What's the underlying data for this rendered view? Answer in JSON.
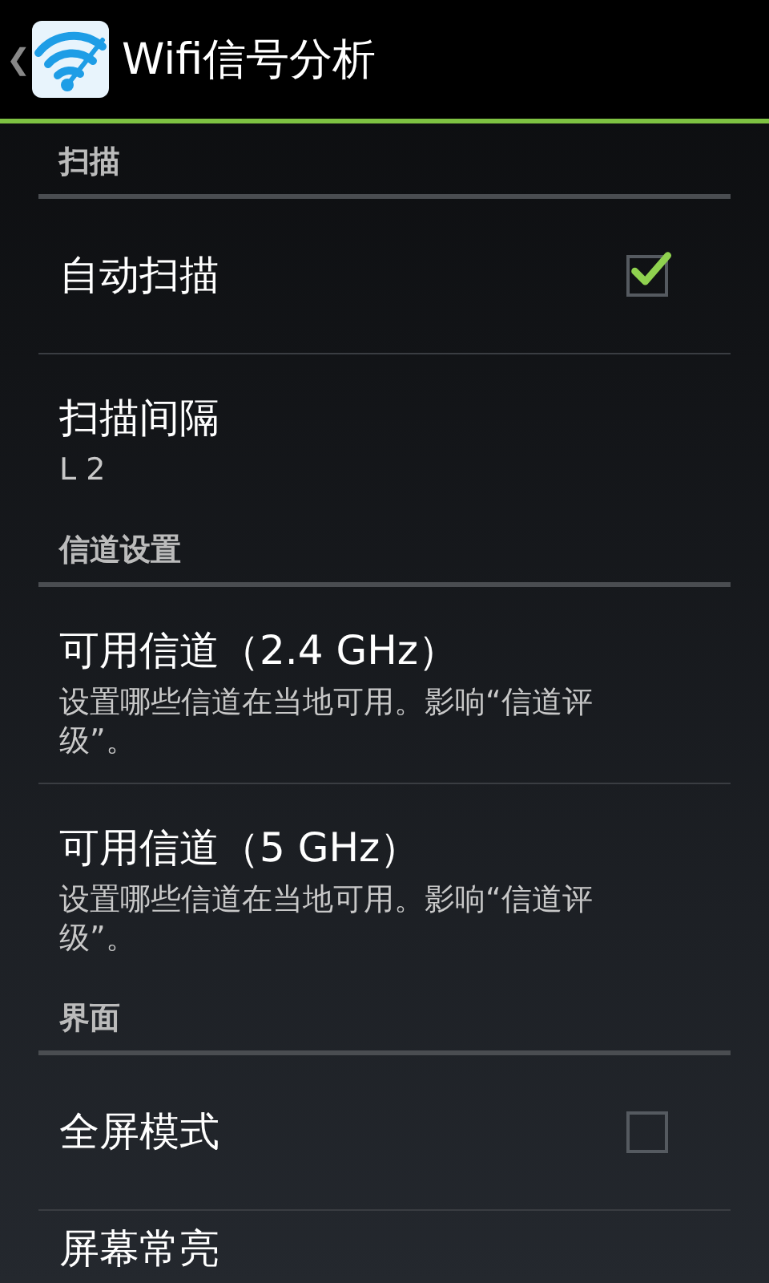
{
  "action_bar": {
    "back": "❮",
    "title": "Wifi信号分析"
  },
  "sections": [
    {
      "title": "扫描",
      "items": [
        {
          "kind": "checkbox",
          "title": "自动扫描",
          "checked": true
        },
        {
          "kind": "summary",
          "title": "扫描间隔",
          "summary": "L 2"
        }
      ]
    },
    {
      "title": "信道设置",
      "items": [
        {
          "kind": "summary",
          "title": "可用信道（2.4 GHz）",
          "summary": "设置哪些信道在当地可用。影响“信道评级”。"
        },
        {
          "kind": "summary",
          "title": "可用信道（5 GHz）",
          "summary": "设置哪些信道在当地可用。影响“信道评级”。"
        }
      ]
    },
    {
      "title": "界面",
      "items": [
        {
          "kind": "checkbox",
          "title": "全屏模式",
          "checked": false
        },
        {
          "kind": "plain",
          "title": "屏幕常亮"
        }
      ]
    }
  ]
}
